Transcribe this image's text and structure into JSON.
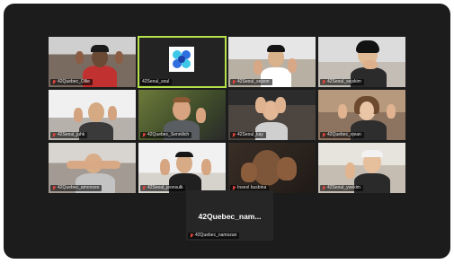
{
  "meeting": {
    "participants": [
      {
        "name": "42Quebec_Ollie",
        "muted": true
      },
      {
        "name": "42Seoul_soul",
        "muted": false,
        "active_speaker": true,
        "logo": "42-seoul-logo"
      },
      {
        "name": "42Seoul_xejson",
        "muted": true
      },
      {
        "name": "42Seoul_sejskim",
        "muted": true
      },
      {
        "name": "42Seoul_juhk",
        "muted": true
      },
      {
        "name": "42Quebec_Sennilich",
        "muted": true
      },
      {
        "name": "42Seoul_kay",
        "muted": true
      },
      {
        "name": "42Quebec_vjean",
        "muted": true
      },
      {
        "name": "42Quebec_amonzeo",
        "muted": true
      },
      {
        "name": "42Seoul_jeonsulk",
        "muted": true
      },
      {
        "name": "Inseol busbina",
        "muted": true
      },
      {
        "name": "42Seoul_yoekim",
        "muted": true
      }
    ],
    "avatar_tile": {
      "display_name": "42Quebec_nam...",
      "name": "42Quebec_namozan",
      "muted": true
    }
  },
  "colors": {
    "window_bg": "#1c1c1c",
    "active_speaker_border": "#b7e14a",
    "muted_icon": "#e0443e"
  }
}
